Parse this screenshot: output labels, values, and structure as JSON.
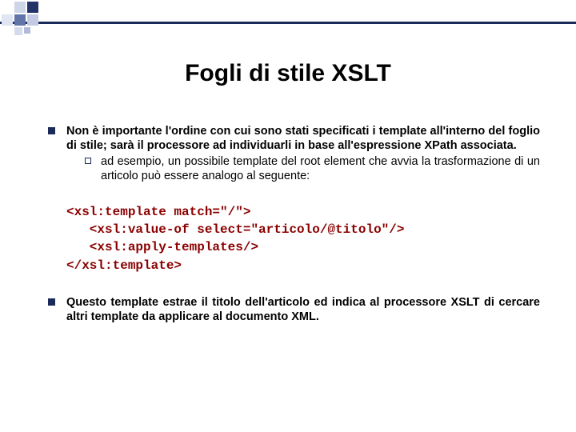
{
  "title": "Fogli di stile XSLT",
  "bullet1": "Non è importante l'ordine con cui sono stati specificati i template all'interno del foglio di stile; sarà il processore ad individuarli in base all'espressione XPath associata.",
  "subbullet1": "ad esempio, un possibile template del root element che avvia la trasformazione di un articolo può essere analogo al seguente:",
  "code": "<xsl:template match=\"/\">\n   <xsl:value-of select=\"articolo/@titolo\"/>\n   <xsl:apply-templates/>\n</xsl:template>",
  "bullet2": "Questo template estrae il titolo dell'articolo ed indica al processore XSLT di cercare altri template da applicare al documento XML."
}
